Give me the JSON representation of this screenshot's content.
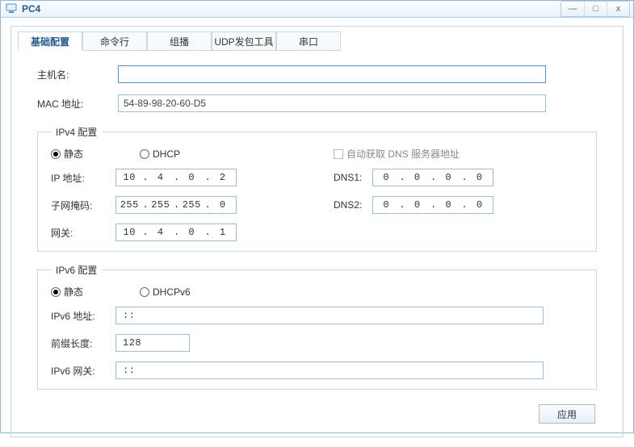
{
  "window": {
    "title": "PC4"
  },
  "winbuttons": {
    "min": "—",
    "max": "□",
    "close": "x"
  },
  "tabs": [
    "基础配置",
    "命令行",
    "组播",
    "UDP发包工具",
    "串口"
  ],
  "host": {
    "label": "主机名:",
    "value": ""
  },
  "mac": {
    "label": "MAC 地址:",
    "value": "54-89-98-20-60-D5"
  },
  "ipv4": {
    "legend": "IPv4 配置",
    "radio_static": "静态",
    "radio_dhcp": "DHCP",
    "auto_dns": "自动获取 DNS 服务器地址",
    "ip_label": "IP 地址:",
    "mask_label": "子网掩码:",
    "gw_label": "网关:",
    "dns1_label": "DNS1:",
    "dns2_label": "DNS2:",
    "ip": [
      "10",
      "4",
      "0",
      "2"
    ],
    "mask": [
      "255",
      "255",
      "255",
      "0"
    ],
    "gw": [
      "10",
      "4",
      "0",
      "1"
    ],
    "dns1": [
      "0",
      "0",
      "0",
      "0"
    ],
    "dns2": [
      "0",
      "0",
      "0",
      "0"
    ]
  },
  "ipv6": {
    "legend": "IPv6 配置",
    "radio_static": "静态",
    "radio_dhcp": "DHCPv6",
    "addr_label": "IPv6 地址:",
    "prefix_label": "前缀长度:",
    "gw_label": "IPv6 网关:",
    "addr": "::",
    "prefix": "128",
    "gw": "::"
  },
  "apply": "应用"
}
